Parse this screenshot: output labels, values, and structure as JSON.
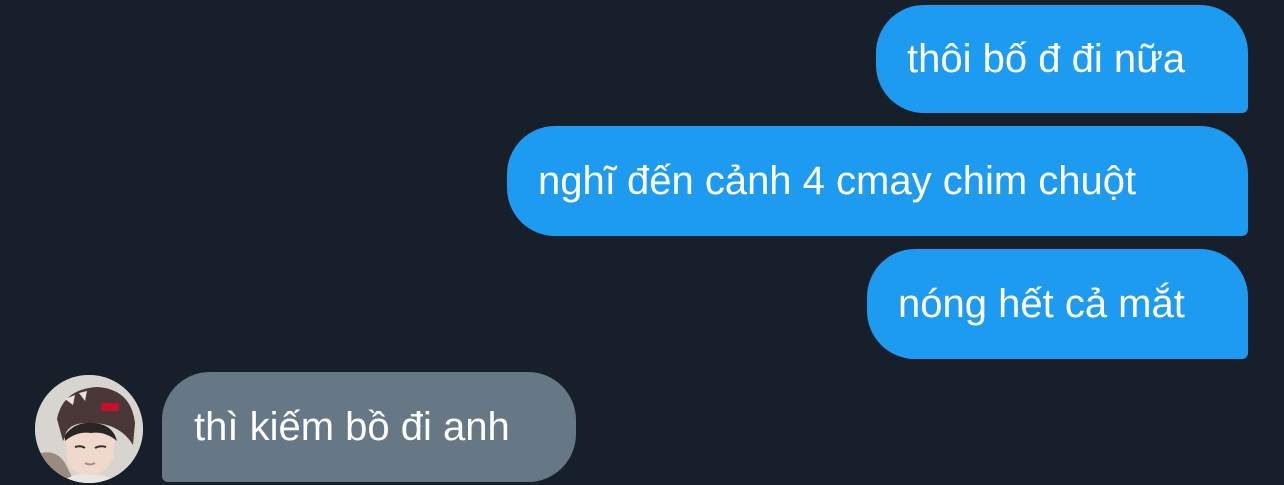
{
  "conversation": {
    "messages": [
      {
        "sender": "me",
        "text": "thôi bố đ đi nữa"
      },
      {
        "sender": "me",
        "text": "nghĩ đến cảnh 4 cmay chim chuột"
      },
      {
        "sender": "me",
        "text": "nóng hết cả mắt"
      },
      {
        "sender": "contact",
        "text": "thì kiếm bồ đi anh"
      }
    ],
    "contact": {
      "avatar_icon": "contact-avatar-photo"
    }
  },
  "colors": {
    "background": "#17202a",
    "sent_bubble": "#1d9bf0",
    "received_bubble": "#667786",
    "text": "#ffffff"
  }
}
